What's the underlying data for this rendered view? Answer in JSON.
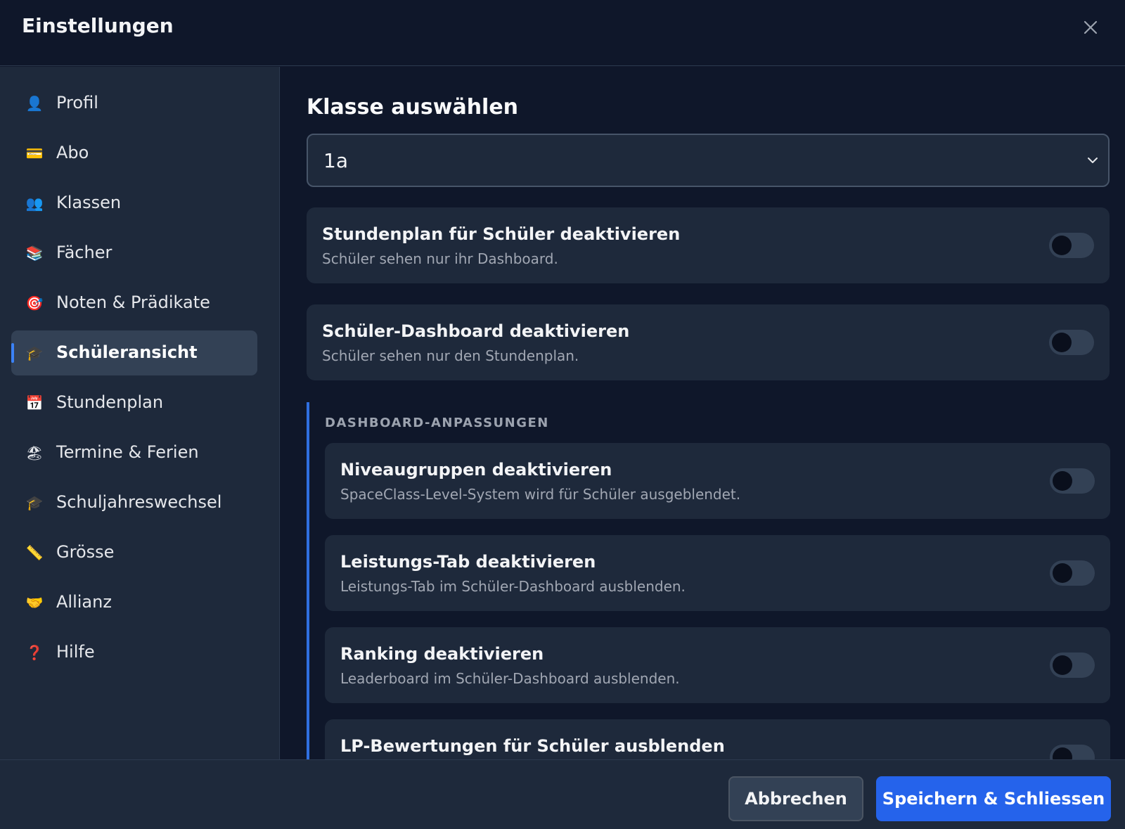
{
  "window": {
    "title": "Einstellungen",
    "close_icon": "close-icon"
  },
  "sidebar": {
    "items": [
      {
        "icon": "👤",
        "icon_name": "person-icon",
        "label": "Profil",
        "active": false
      },
      {
        "icon": "💳",
        "icon_name": "credit-card-icon",
        "label": "Abo",
        "active": false
      },
      {
        "icon": "👥",
        "icon_name": "people-icon",
        "label": "Klassen",
        "active": false
      },
      {
        "icon": "📚",
        "icon_name": "books-icon",
        "label": "Fächer",
        "active": false
      },
      {
        "icon": "🎯",
        "icon_name": "target-icon",
        "label": "Noten & Prädikate",
        "active": false
      },
      {
        "icon": "🎓",
        "icon_name": "graduation-cap-icon",
        "label": "Schüleransicht",
        "active": true
      },
      {
        "icon": "📅",
        "icon_name": "calendar-icon",
        "label": "Stundenplan",
        "active": false
      },
      {
        "icon": "🏖",
        "icon_name": "beach-icon",
        "label": "Termine & Ferien",
        "active": false
      },
      {
        "icon": "🎓",
        "icon_name": "graduation-cap-icon",
        "label": "Schuljahreswechsel",
        "active": false
      },
      {
        "icon": "📏",
        "icon_name": "ruler-icon",
        "label": "Grösse",
        "active": false
      },
      {
        "icon": "🤝",
        "icon_name": "handshake-icon",
        "label": "Allianz",
        "active": false
      },
      {
        "icon": "❓",
        "icon_name": "question-mark-icon",
        "label": "Hilfe",
        "active": false
      }
    ]
  },
  "main": {
    "section_title": "Klasse auswählen",
    "class_select": {
      "value": "1a"
    },
    "settings": [
      {
        "title": "Stundenplan für Schüler deaktivieren",
        "description": "Schüler sehen nur ihr Dashboard.",
        "enabled": false
      },
      {
        "title": "Schüler-Dashboard deaktivieren",
        "description": "Schüler sehen nur den Stundenplan.",
        "enabled": false
      }
    ],
    "dashboard_group": {
      "label": "DASHBOARD-ANPASSUNGEN",
      "settings": [
        {
          "title": "Niveaugruppen deaktivieren",
          "description": "SpaceClass-Level-System wird für Schüler ausgeblendet.",
          "enabled": false
        },
        {
          "title": "Leistungs-Tab deaktivieren",
          "description": "Leistungs-Tab im Schüler-Dashboard ausblenden.",
          "enabled": false
        },
        {
          "title": "Ranking deaktivieren",
          "description": "Leaderboard im Schüler-Dashboard ausblenden.",
          "enabled": false
        },
        {
          "title": "LP-Bewertungen für Schüler ausblenden",
          "description": "",
          "enabled": false
        }
      ]
    }
  },
  "footer": {
    "cancel_label": "Abbrechen",
    "save_label": "Speichern & Schliessen"
  },
  "colors": {
    "background": "#0f172a",
    "panel": "#1e293b",
    "accent": "#2563eb"
  }
}
